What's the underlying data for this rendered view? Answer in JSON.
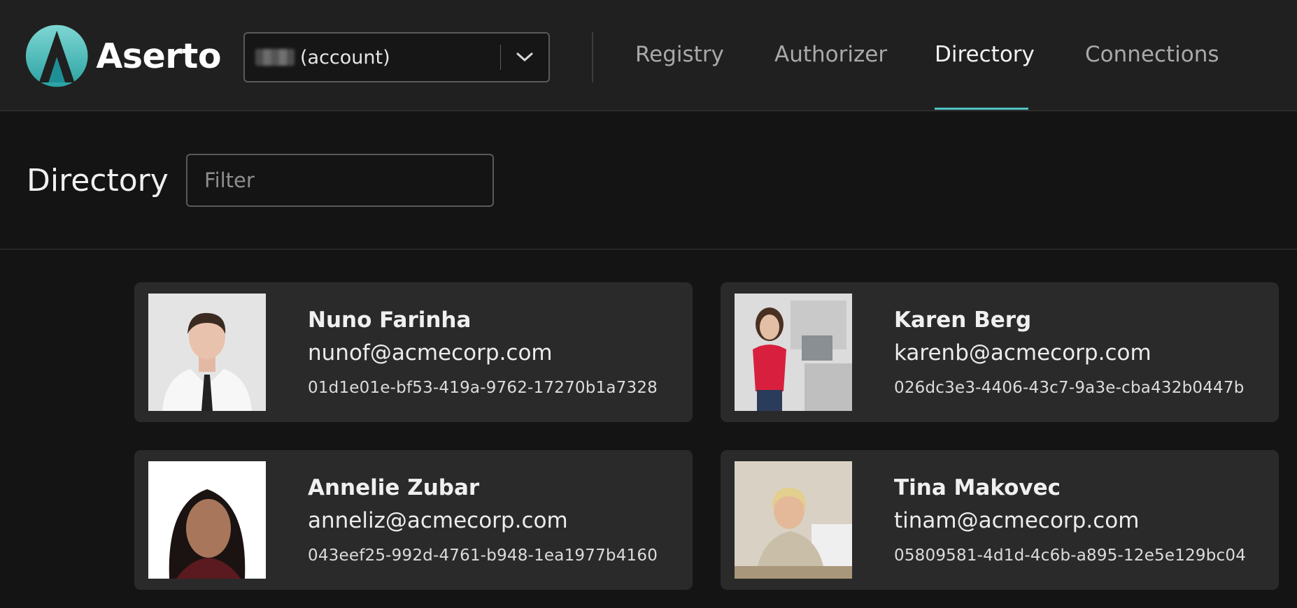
{
  "app": {
    "logo_text": "Aserto",
    "brand_color": "#4fc3c3"
  },
  "account": {
    "label": "(account)"
  },
  "nav": {
    "tabs": [
      {
        "label": "Registry",
        "active": false
      },
      {
        "label": "Authorizer",
        "active": false
      },
      {
        "label": "Directory",
        "active": true
      },
      {
        "label": "Connections",
        "active": false
      }
    ]
  },
  "page": {
    "title": "Directory",
    "filter_placeholder": "Filter",
    "filter_value": ""
  },
  "users": [
    {
      "name": "Nuno Farinha",
      "email": "nunof@acmecorp.com",
      "id": "01d1e01e-bf53-419a-9762-17270b1a7328"
    },
    {
      "name": "Karen Berg",
      "email": "karenb@acmecorp.com",
      "id": "026dc3e3-4406-43c7-9a3e-cba432b0447b"
    },
    {
      "name": "Annelie Zubar",
      "email": "anneliz@acmecorp.com",
      "id": "043eef25-992d-4761-b948-1ea1977b4160"
    },
    {
      "name": "Tina Makovec",
      "email": "tinam@acmecorp.com",
      "id": "05809581-4d1d-4c6b-a895-12e5e129bc04"
    }
  ]
}
